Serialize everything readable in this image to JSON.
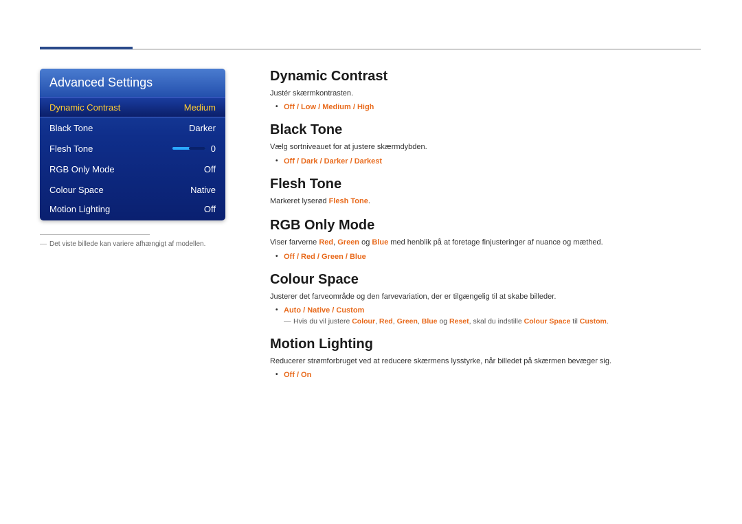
{
  "panel": {
    "title": "Advanced Settings",
    "rows": [
      {
        "label": "Dynamic Contrast",
        "value": "Medium",
        "selected": true
      },
      {
        "label": "Black Tone",
        "value": "Darker"
      },
      {
        "label": "Flesh Tone",
        "value": "0",
        "slider": true
      },
      {
        "label": "RGB Only Mode",
        "value": "Off"
      },
      {
        "label": "Colour Space",
        "value": "Native"
      },
      {
        "label": "Motion Lighting",
        "value": "Off"
      }
    ]
  },
  "panel_footnote": "Det viste billede kan variere afhængigt af modellen.",
  "sections": {
    "dynamic_contrast": {
      "title": "Dynamic Contrast",
      "desc": "Justér skærmkontrasten.",
      "options": "Off / Low / Medium / High"
    },
    "black_tone": {
      "title": "Black Tone",
      "desc": "Vælg sortniveauet for at justere skærmdybden.",
      "options": "Off / Dark / Darker / Darkest"
    },
    "flesh_tone": {
      "title": "Flesh Tone",
      "desc_pre": "Markeret lyserød ",
      "desc_hl": "Flesh Tone",
      "desc_post": "."
    },
    "rgb_only": {
      "title": "RGB Only Mode",
      "desc_pre": "Viser farverne ",
      "r": "Red",
      "c1": ", ",
      "g": "Green",
      "c2": " og ",
      "b": "Blue",
      "desc_post": " med henblik på at foretage finjusteringer af nuance og mæthed.",
      "options": "Off / Red / Green / Blue"
    },
    "colour_space": {
      "title": "Colour Space",
      "desc": "Justerer det farveområde og den farvevariation, der er tilgængelig til at skabe billeder.",
      "options": "Auto / Native / Custom",
      "note_pre": "Hvis du vil justere ",
      "n1": "Colour",
      "s1": ", ",
      "n2": "Red",
      "s2": ", ",
      "n3": "Green",
      "s3": ", ",
      "n4": "Blue",
      "s4": " og ",
      "n5": "Reset",
      "note_mid": ", skal du indstille ",
      "n6": "Colour Space",
      "note_mid2": " til ",
      "n7": "Custom",
      "note_end": "."
    },
    "motion_lighting": {
      "title": "Motion Lighting",
      "desc": "Reducerer strømforbruget ved at reducere skærmens lysstyrke, når billedet på skærmen bevæger sig.",
      "options": "Off / On"
    }
  }
}
